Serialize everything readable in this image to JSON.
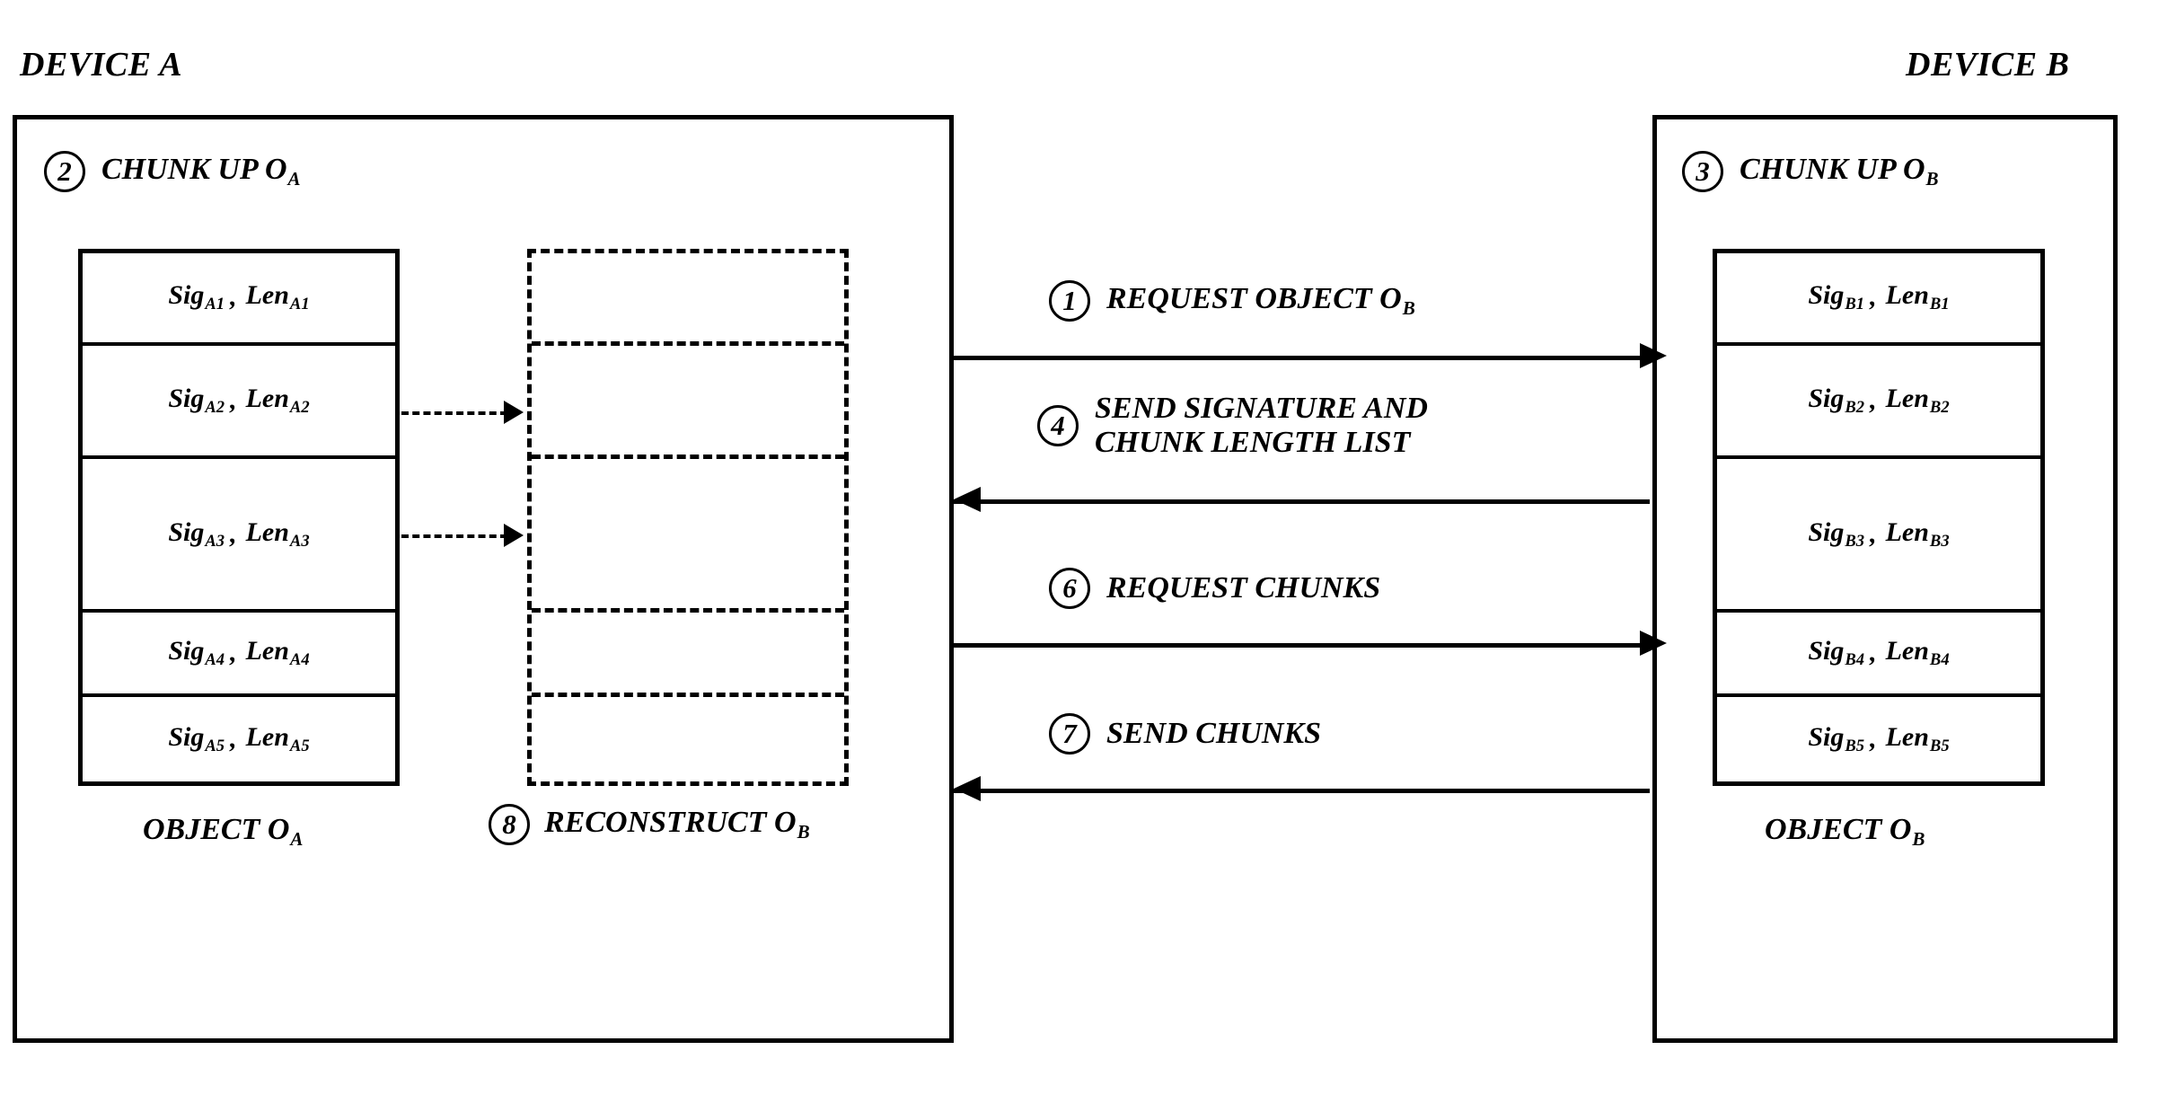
{
  "devices": {
    "a": {
      "caption": "DEVICE A",
      "chunk_up_step": "2",
      "chunk_up_label": "CHUNK UP O",
      "chunk_up_subscript": "A",
      "object_caption": "OBJECT O",
      "object_caption_subscript": "A",
      "chunks": [
        {
          "sig": "Sig",
          "sig_sub": "A1",
          "comma": ",",
          "len": "Len",
          "len_sub": "A1"
        },
        {
          "sig": "Sig",
          "sig_sub": "A2",
          "comma": ",",
          "len": "Len",
          "len_sub": "A2"
        },
        {
          "sig": "Sig",
          "sig_sub": "A3",
          "comma": ",",
          "len": "Len",
          "len_sub": "A3"
        },
        {
          "sig": "Sig",
          "sig_sub": "A4",
          "comma": ",",
          "len": "Len",
          "len_sub": "A4"
        },
        {
          "sig": "Sig",
          "sig_sub": "A5",
          "comma": ",",
          "len": "Len",
          "len_sub": "A5"
        }
      ]
    },
    "b": {
      "caption": "DEVICE B",
      "chunk_up_step": "3",
      "chunk_up_label": "CHUNK UP O",
      "chunk_up_subscript": "B",
      "object_caption": "OBJECT O",
      "object_caption_subscript": "B",
      "chunks": [
        {
          "sig": "Sig",
          "sig_sub": "B1",
          "comma": ",",
          "len": "Len",
          "len_sub": "B1"
        },
        {
          "sig": "Sig",
          "sig_sub": "B2",
          "comma": ",",
          "len": "Len",
          "len_sub": "B2"
        },
        {
          "sig": "Sig",
          "sig_sub": "B3",
          "comma": ",",
          "len": "Len",
          "len_sub": "B3"
        },
        {
          "sig": "Sig",
          "sig_sub": "B4",
          "comma": ",",
          "len": "Len",
          "len_sub": "B4"
        },
        {
          "sig": "Sig",
          "sig_sub": "B5",
          "comma": ",",
          "len": "Len",
          "len_sub": "B5"
        }
      ]
    }
  },
  "reconstruct": {
    "step": "8",
    "label": "RECONSTRUCT O",
    "subscript": "B"
  },
  "messages": [
    {
      "step": "1",
      "text": "REQUEST OBJECT O",
      "subscript": "B",
      "line2": "",
      "direction": "right"
    },
    {
      "step": "4",
      "text": "SEND SIGNATURE AND",
      "subscript": "",
      "line2": "CHUNK LENGTH LIST",
      "direction": "left"
    },
    {
      "step": "6",
      "text": "REQUEST CHUNKS",
      "subscript": "",
      "line2": "",
      "direction": "right"
    },
    {
      "step": "7",
      "text": "SEND CHUNKS",
      "subscript": "",
      "line2": "",
      "direction": "left"
    }
  ],
  "colors": {
    "ink": "#000000",
    "paper": "#ffffff"
  }
}
